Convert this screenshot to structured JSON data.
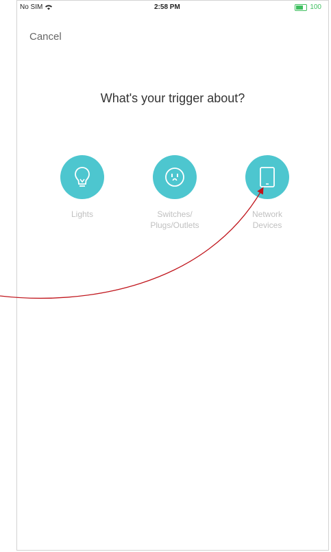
{
  "statusbar": {
    "carrier": "No SIM",
    "time": "2:58 PM",
    "battery_text": "100"
  },
  "header": {
    "cancel_label": "Cancel"
  },
  "main": {
    "title": "What's your trigger about?",
    "options": [
      {
        "label": "Lights",
        "icon": "lightbulb-icon"
      },
      {
        "label": "Switches/\nPlugs/Outlets",
        "icon": "outlet-icon"
      },
      {
        "label": "Network\nDevices",
        "icon": "tablet-device-icon"
      }
    ]
  },
  "colors": {
    "accent": "#4dc6cf",
    "annotation_arrow": "#c0151c"
  }
}
